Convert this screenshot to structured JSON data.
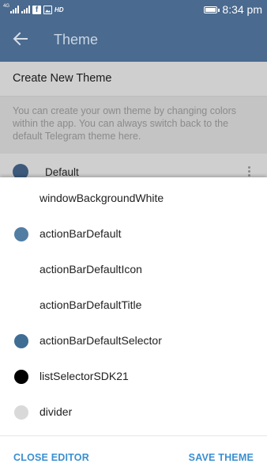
{
  "status_bar": {
    "network_label": "4G",
    "hd_label": "HD",
    "time": "8:34 pm",
    "icons": [
      "signal-icon",
      "signal-icon",
      "facebook-icon",
      "image-icon",
      "battery-icon"
    ]
  },
  "action_bar": {
    "title": "Theme",
    "back_icon": "arrow-left-icon",
    "color": "#4a6a8f"
  },
  "settings": {
    "create_new_theme": "Create New Theme",
    "info_text": "You can create your own theme by changing colors within the app. You can always switch back to the default Telegram theme here.",
    "theme_name": "Default",
    "theme_color": "#3d5a7c"
  },
  "editor": {
    "items": [
      {
        "label": "windowBackgroundWhite",
        "swatch": "#ffffff"
      },
      {
        "label": "actionBarDefault",
        "swatch": "#527da3"
      },
      {
        "label": "actionBarDefaultIcon",
        "swatch": "#ffffff"
      },
      {
        "label": "actionBarDefaultTitle",
        "swatch": "#ffffff"
      },
      {
        "label": "actionBarDefaultSelector",
        "swatch": "#406d94"
      },
      {
        "label": "listSelectorSDK21",
        "swatch": "#000000"
      },
      {
        "label": "divider",
        "swatch": "#d9d9d9"
      }
    ],
    "close_label": "CLOSE EDITOR",
    "save_label": "SAVE THEME",
    "button_color": "#3a8fd1"
  }
}
